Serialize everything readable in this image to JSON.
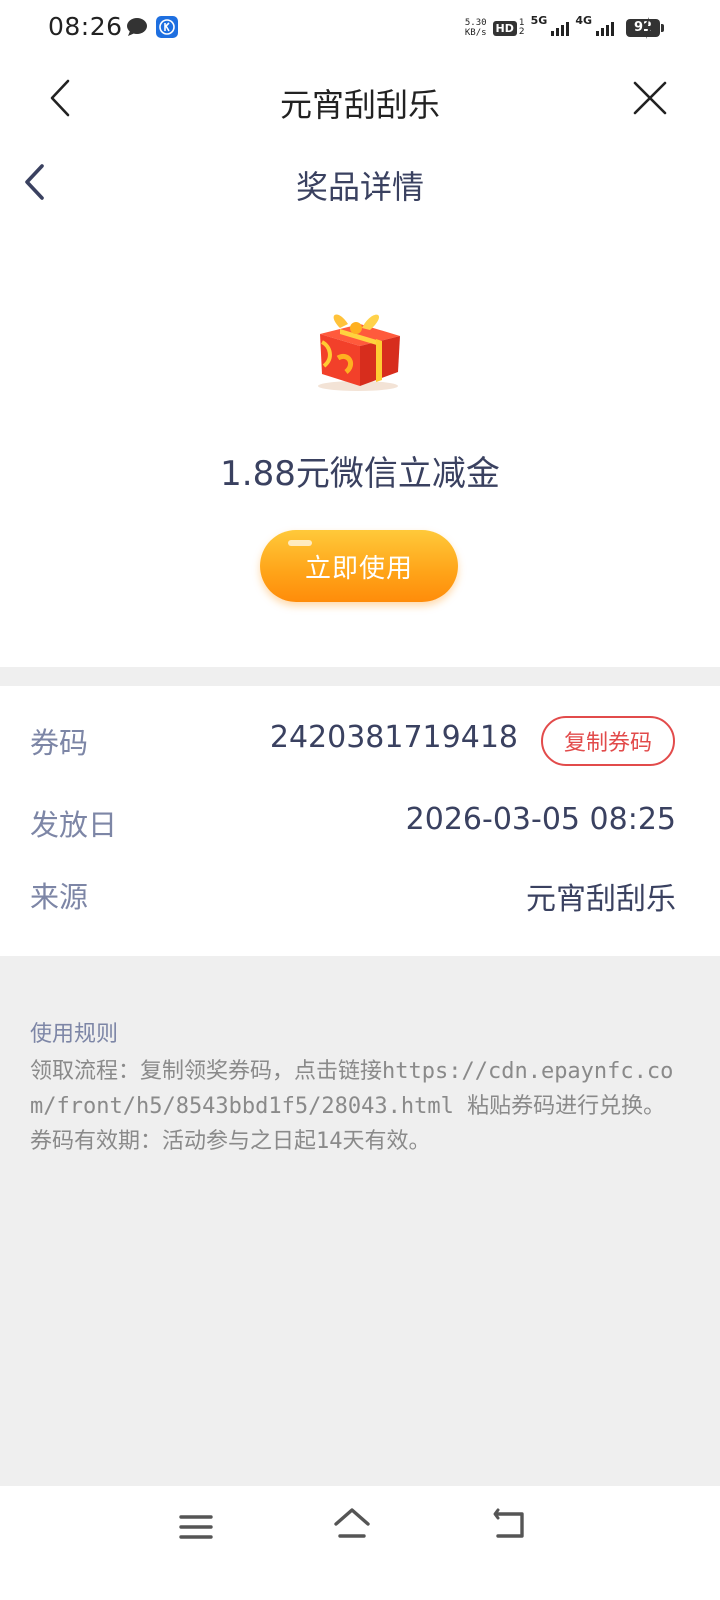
{
  "status_bar": {
    "time": "08:26",
    "net_speed_value": "5.30",
    "net_speed_unit": "KB/s",
    "hd_label": "HD",
    "hd_sub": "1\n2",
    "signal1_label": "5G",
    "signal2_label": "4G",
    "battery": "92"
  },
  "header": {
    "title": "元宵刮刮乐"
  },
  "subheader": {
    "title": "奖品详情"
  },
  "prize": {
    "name": "1.88元微信立减金",
    "use_button_label": "立即使用"
  },
  "details": {
    "coupon_label": "券码",
    "coupon_value": "2420381719418",
    "copy_button_label": "复制券码",
    "issue_date_label": "发放日",
    "issue_date_value": "2026-03-05 08:25",
    "source_label": "来源",
    "source_value": "元宵刮刮乐"
  },
  "rules": {
    "title": "使用规则",
    "text": "领取流程：复制领奖券码，点击链接https://cdn.epaynfc.com/front/h5/8543bbd1f5/28043.html  粘贴券码进行兑换。券码有效期：活动参与之日起14天有效。"
  },
  "colors": {
    "accent_orange": "#ffa318",
    "copy_red": "#e24b4b",
    "text_dark": "#3a4160",
    "label_gray": "#7d86a6",
    "page_bg": "#efefef"
  },
  "icons": {
    "status_chat": "chat-bubble-icon",
    "status_app": "app-k-icon",
    "header_back": "chevron-left-icon",
    "header_close": "close-icon",
    "sub_back": "chevron-left-icon",
    "gift": "gift-box-icon",
    "nav_menu": "menu-icon",
    "nav_home": "home-icon",
    "nav_back": "back-icon"
  }
}
